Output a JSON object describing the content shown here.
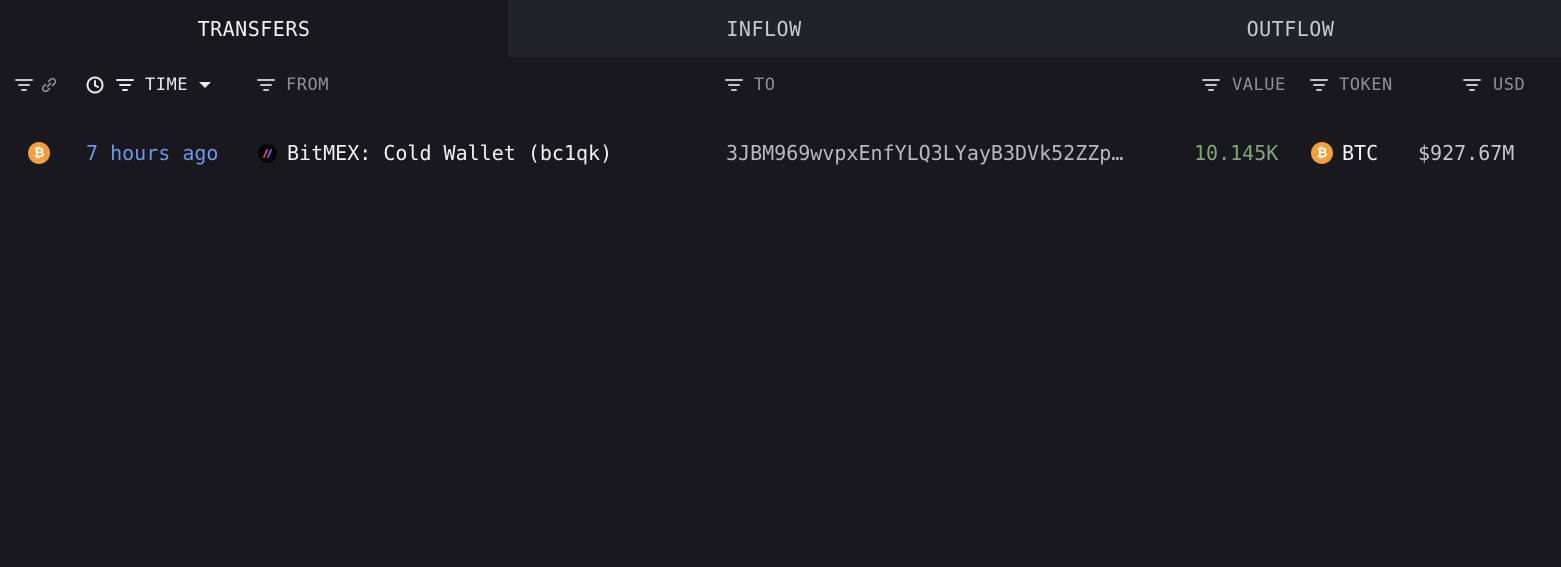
{
  "tabs": [
    {
      "label": "TRANSFERS",
      "active": true
    },
    {
      "label": "INFLOW",
      "active": false
    },
    {
      "label": "OUTFLOW",
      "active": false
    }
  ],
  "columns": {
    "time": "TIME",
    "from": "FROM",
    "to": "TO",
    "value": "VALUE",
    "token": "TOKEN",
    "usd": "USD"
  },
  "rows": [
    {
      "chain_icon": "btc-coin-icon",
      "time": "7 hours ago",
      "from_icon": "bitmex-icon",
      "from": "BitMEX: Cold Wallet (bc1qk)",
      "to": "3JBM969wvpxEnfYLQ3LYayB3DVk52ZZp…",
      "value": "10.145K",
      "token_icon": "btc-coin-icon",
      "token": "BTC",
      "usd": "$927.67M"
    }
  ],
  "colors": {
    "background": "#18181e",
    "tab_inactive_bg": "#22222a",
    "time_link": "#6f96e6",
    "value_green": "#7fa779",
    "btc_orange": "#f0a040",
    "header_text": "#8f8f98"
  }
}
